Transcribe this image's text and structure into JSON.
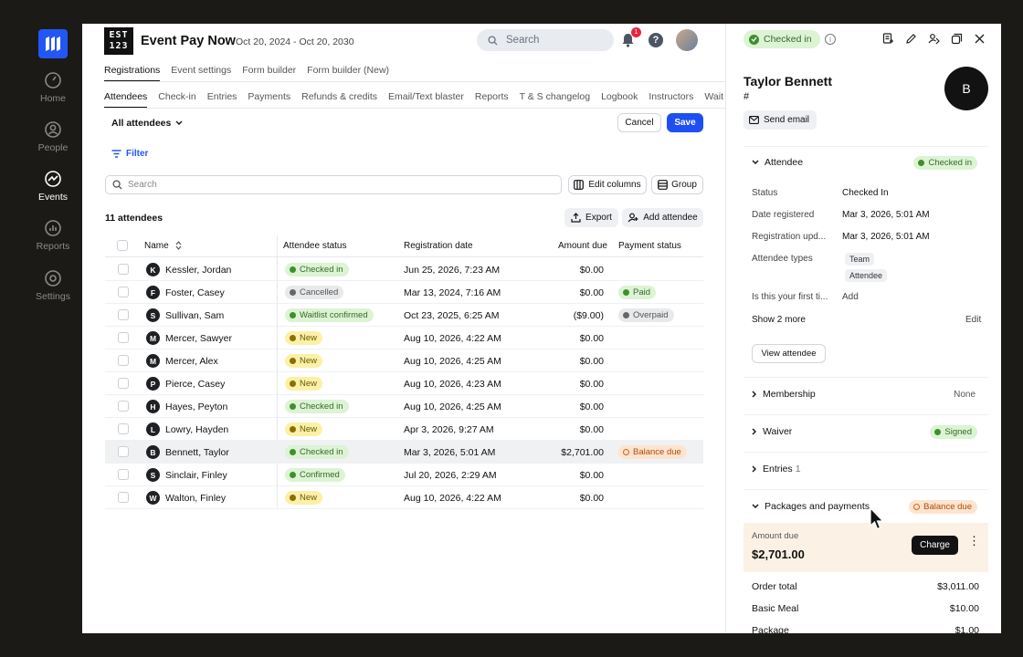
{
  "nav": {
    "items": [
      {
        "label": "Home",
        "icon": "gauge-icon"
      },
      {
        "label": "People",
        "icon": "person-icon"
      },
      {
        "label": "Events",
        "icon": "events-icon"
      },
      {
        "label": "Reports",
        "icon": "chart-icon"
      },
      {
        "label": "Settings",
        "icon": "gear-icon"
      }
    ]
  },
  "header": {
    "event_logo_text": "ESTIN 123",
    "title": "Event Pay Now",
    "dates": "Oct 20, 2024 - Oct 20, 2030",
    "search_placeholder": "Search",
    "notification_count": "1",
    "help": "?"
  },
  "tabs_primary": [
    "Registrations",
    "Event settings",
    "Form builder",
    "Form builder (New)"
  ],
  "tabs_secondary": [
    "Attendees",
    "Check-in",
    "Entries",
    "Payments",
    "Refunds & credits",
    "Email/Text blaster",
    "Reports",
    "T & S changelog",
    "Logbook",
    "Instructors",
    "Wait"
  ],
  "toolbar": {
    "view_label": "All attendees",
    "cancel_label": "Cancel",
    "save_label": "Save",
    "filter_label": "Filter",
    "search_placeholder": "Search",
    "edit_columns_label": "Edit columns",
    "group_label": "Group",
    "count_label": "11 attendees",
    "export_label": "Export",
    "add_label": "Add attendee"
  },
  "table": {
    "columns": [
      "Name",
      "Attendee status",
      "Registration date",
      "Amount due",
      "Payment status"
    ],
    "rows": [
      {
        "initial": "K",
        "name": "Kessler, Jordan",
        "status": "Checked in",
        "status_type": "checked",
        "date": "Jun 25, 2026, 7:23 AM",
        "amount": "$0.00",
        "payment": "",
        "payment_type": ""
      },
      {
        "initial": "F",
        "name": "Foster, Casey",
        "status": "Cancelled",
        "status_type": "cancelled",
        "date": "Mar 13, 2024, 7:16 AM",
        "amount": "$0.00",
        "payment": "Paid",
        "payment_type": "paid"
      },
      {
        "initial": "S",
        "name": "Sullivan, Sam",
        "status": "Waitlist confirmed",
        "status_type": "waitlist",
        "date": "Oct 23, 2025, 6:25 AM",
        "amount": "($9.00)",
        "payment": "Overpaid",
        "payment_type": "over"
      },
      {
        "initial": "M",
        "name": "Mercer, Sawyer",
        "status": "New",
        "status_type": "new",
        "date": "Aug 10, 2026, 4:22 AM",
        "amount": "$0.00",
        "payment": "",
        "payment_type": ""
      },
      {
        "initial": "M",
        "name": "Mercer, Alex",
        "status": "New",
        "status_type": "new",
        "date": "Aug 10, 2026, 4:25 AM",
        "amount": "$0.00",
        "payment": "",
        "payment_type": ""
      },
      {
        "initial": "P",
        "name": "Pierce, Casey",
        "status": "New",
        "status_type": "new",
        "date": "Aug 10, 2026, 4:23 AM",
        "amount": "$0.00",
        "payment": "",
        "payment_type": ""
      },
      {
        "initial": "H",
        "name": "Hayes, Peyton",
        "status": "Checked in",
        "status_type": "checked",
        "date": "Aug 10, 2026, 4:25 AM",
        "amount": "$0.00",
        "payment": "",
        "payment_type": ""
      },
      {
        "initial": "L",
        "name": "Lowry, Hayden",
        "status": "New",
        "status_type": "new",
        "date": "Apr 3, 2026, 9:27 AM",
        "amount": "$0.00",
        "payment": "",
        "payment_type": ""
      },
      {
        "initial": "B",
        "name": "Bennett, Taylor",
        "status": "Checked in",
        "status_type": "checked",
        "date": "Mar 3, 2026, 5:01 AM",
        "amount": "$2,701.00",
        "payment": "Balance due",
        "payment_type": "bal",
        "selected": true
      },
      {
        "initial": "S",
        "name": "Sinclair, Finley",
        "status": "Confirmed",
        "status_type": "confirmed",
        "date": "Jul 20, 2026, 2:29 AM",
        "amount": "$0.00",
        "payment": "",
        "payment_type": ""
      },
      {
        "initial": "W",
        "name": "Walton, Finley",
        "status": "New",
        "status_type": "new",
        "date": "Aug 10, 2026, 4:22 AM",
        "amount": "$0.00",
        "payment": "",
        "payment_type": ""
      }
    ]
  },
  "panel": {
    "checked_badge": "Checked in",
    "name": "Taylor Bennett",
    "hash": "#",
    "avatar_initial": "B",
    "send_email": "Send email",
    "attendee_section": {
      "title": "Attendee",
      "badge": "Checked in",
      "fields": [
        {
          "label": "Status",
          "value": "Checked In"
        },
        {
          "label": "Date registered",
          "value": "Mar 3, 2026, 5:01 AM"
        },
        {
          "label": "Registration upd...",
          "value": "Mar 3, 2026, 5:01 AM"
        },
        {
          "label": "Attendee types",
          "value": ""
        },
        {
          "label": "Is this your first ti...",
          "value": "Add"
        }
      ],
      "types": [
        "Team",
        "Attendee"
      ],
      "show_more": "Show 2 more",
      "edit": "Edit",
      "view_attendee": "View attendee"
    },
    "membership": {
      "title": "Membership",
      "value": "None"
    },
    "waiver": {
      "title": "Waiver",
      "badge": "Signed"
    },
    "entries": {
      "title": "Entries",
      "count": "1"
    },
    "packages": {
      "title": "Packages and payments",
      "badge": "Balance due"
    },
    "amount_due_label": "Amount due",
    "amount_due_value": "$2,701.00",
    "charge_label": "Charge",
    "totals": [
      {
        "label": "Order total",
        "value": "$3,011.00"
      },
      {
        "label": "Basic Meal",
        "value": "$10.00"
      },
      {
        "label": "Package",
        "value": "$1.00"
      }
    ]
  },
  "colors": {
    "accent": "#1d4ff2",
    "status_green": "#3f8f2f",
    "status_yellow": "#fbf0a7",
    "balance_orange": "#d86412"
  }
}
